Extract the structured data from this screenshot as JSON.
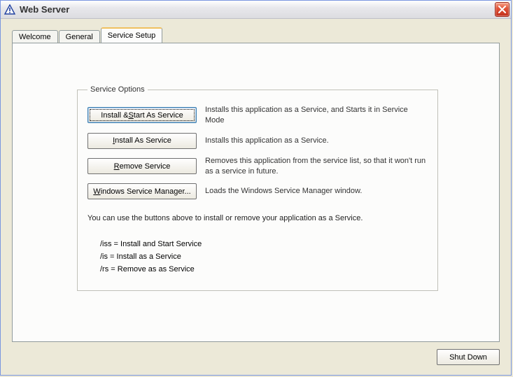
{
  "window": {
    "title": "Web Server"
  },
  "tabs": [
    {
      "label": "Welcome",
      "active": false
    },
    {
      "label": "General",
      "active": false
    },
    {
      "label": "Service Setup",
      "active": true
    }
  ],
  "group": {
    "legend": "Service Options",
    "rows": [
      {
        "button_prefix": "Install & ",
        "button_accel": "S",
        "button_suffix": "tart As Service",
        "desc": "Installs this application as a Service, and Starts it in Service Mode"
      },
      {
        "button_prefix": "",
        "button_accel": "I",
        "button_suffix": "nstall As Service",
        "desc": "Installs this application as a Service."
      },
      {
        "button_prefix": "",
        "button_accel": "R",
        "button_suffix": "emove Service",
        "desc": "Removes this application from the service list, so that it won't run as a service in future."
      },
      {
        "button_prefix": "",
        "button_accel": "W",
        "button_suffix": "indows Service Manager...",
        "desc": "Loads the Windows Service Manager window."
      }
    ],
    "note": "You can use the buttons above to install or remove your application as a Service.",
    "commands": [
      "/iss = Install and Start Service",
      "/is = Install as a Service",
      "/rs = Remove as as Service"
    ]
  },
  "footer": {
    "shutdown_label": "Shut Down"
  }
}
